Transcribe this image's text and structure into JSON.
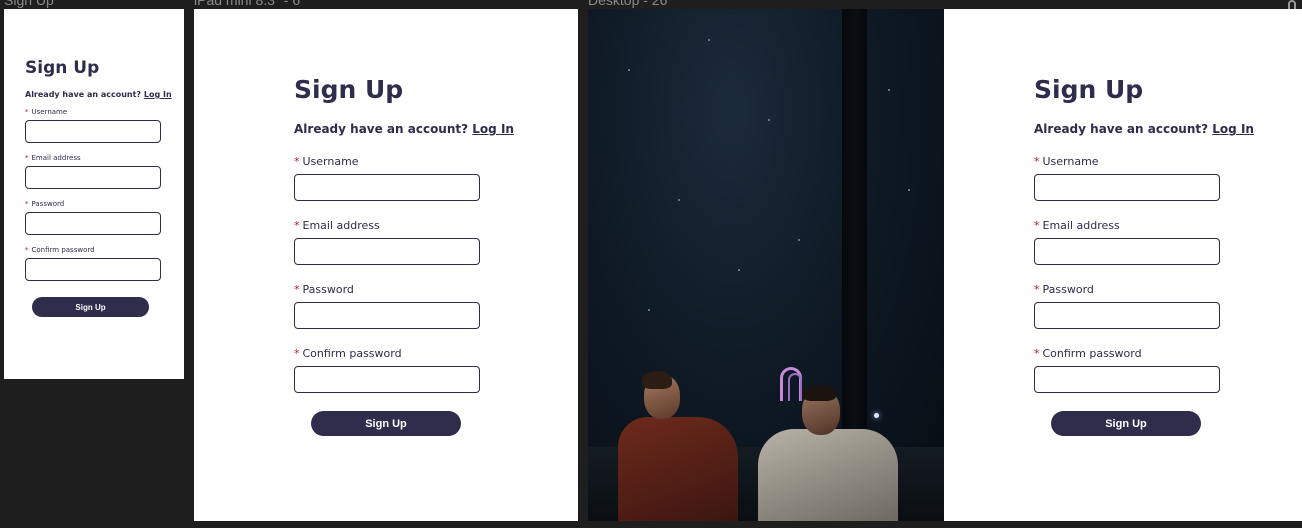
{
  "frame_labels": {
    "mobile": "Sign Up",
    "ipad": "iPad mini 8.3\" - 6",
    "desktop": "Desktop - 26"
  },
  "form": {
    "title": "Sign Up",
    "already_text": "Already have an account?",
    "login_link": "Log In",
    "required_marker": "*",
    "fields": {
      "username": "Username",
      "email": "Email address",
      "password": "Password",
      "confirm": "Confirm password"
    },
    "submit_label": "Sign Up"
  },
  "colors": {
    "primary": "#2f2c4c",
    "required": "#c8102e",
    "canvas": "#1e1e1e"
  }
}
